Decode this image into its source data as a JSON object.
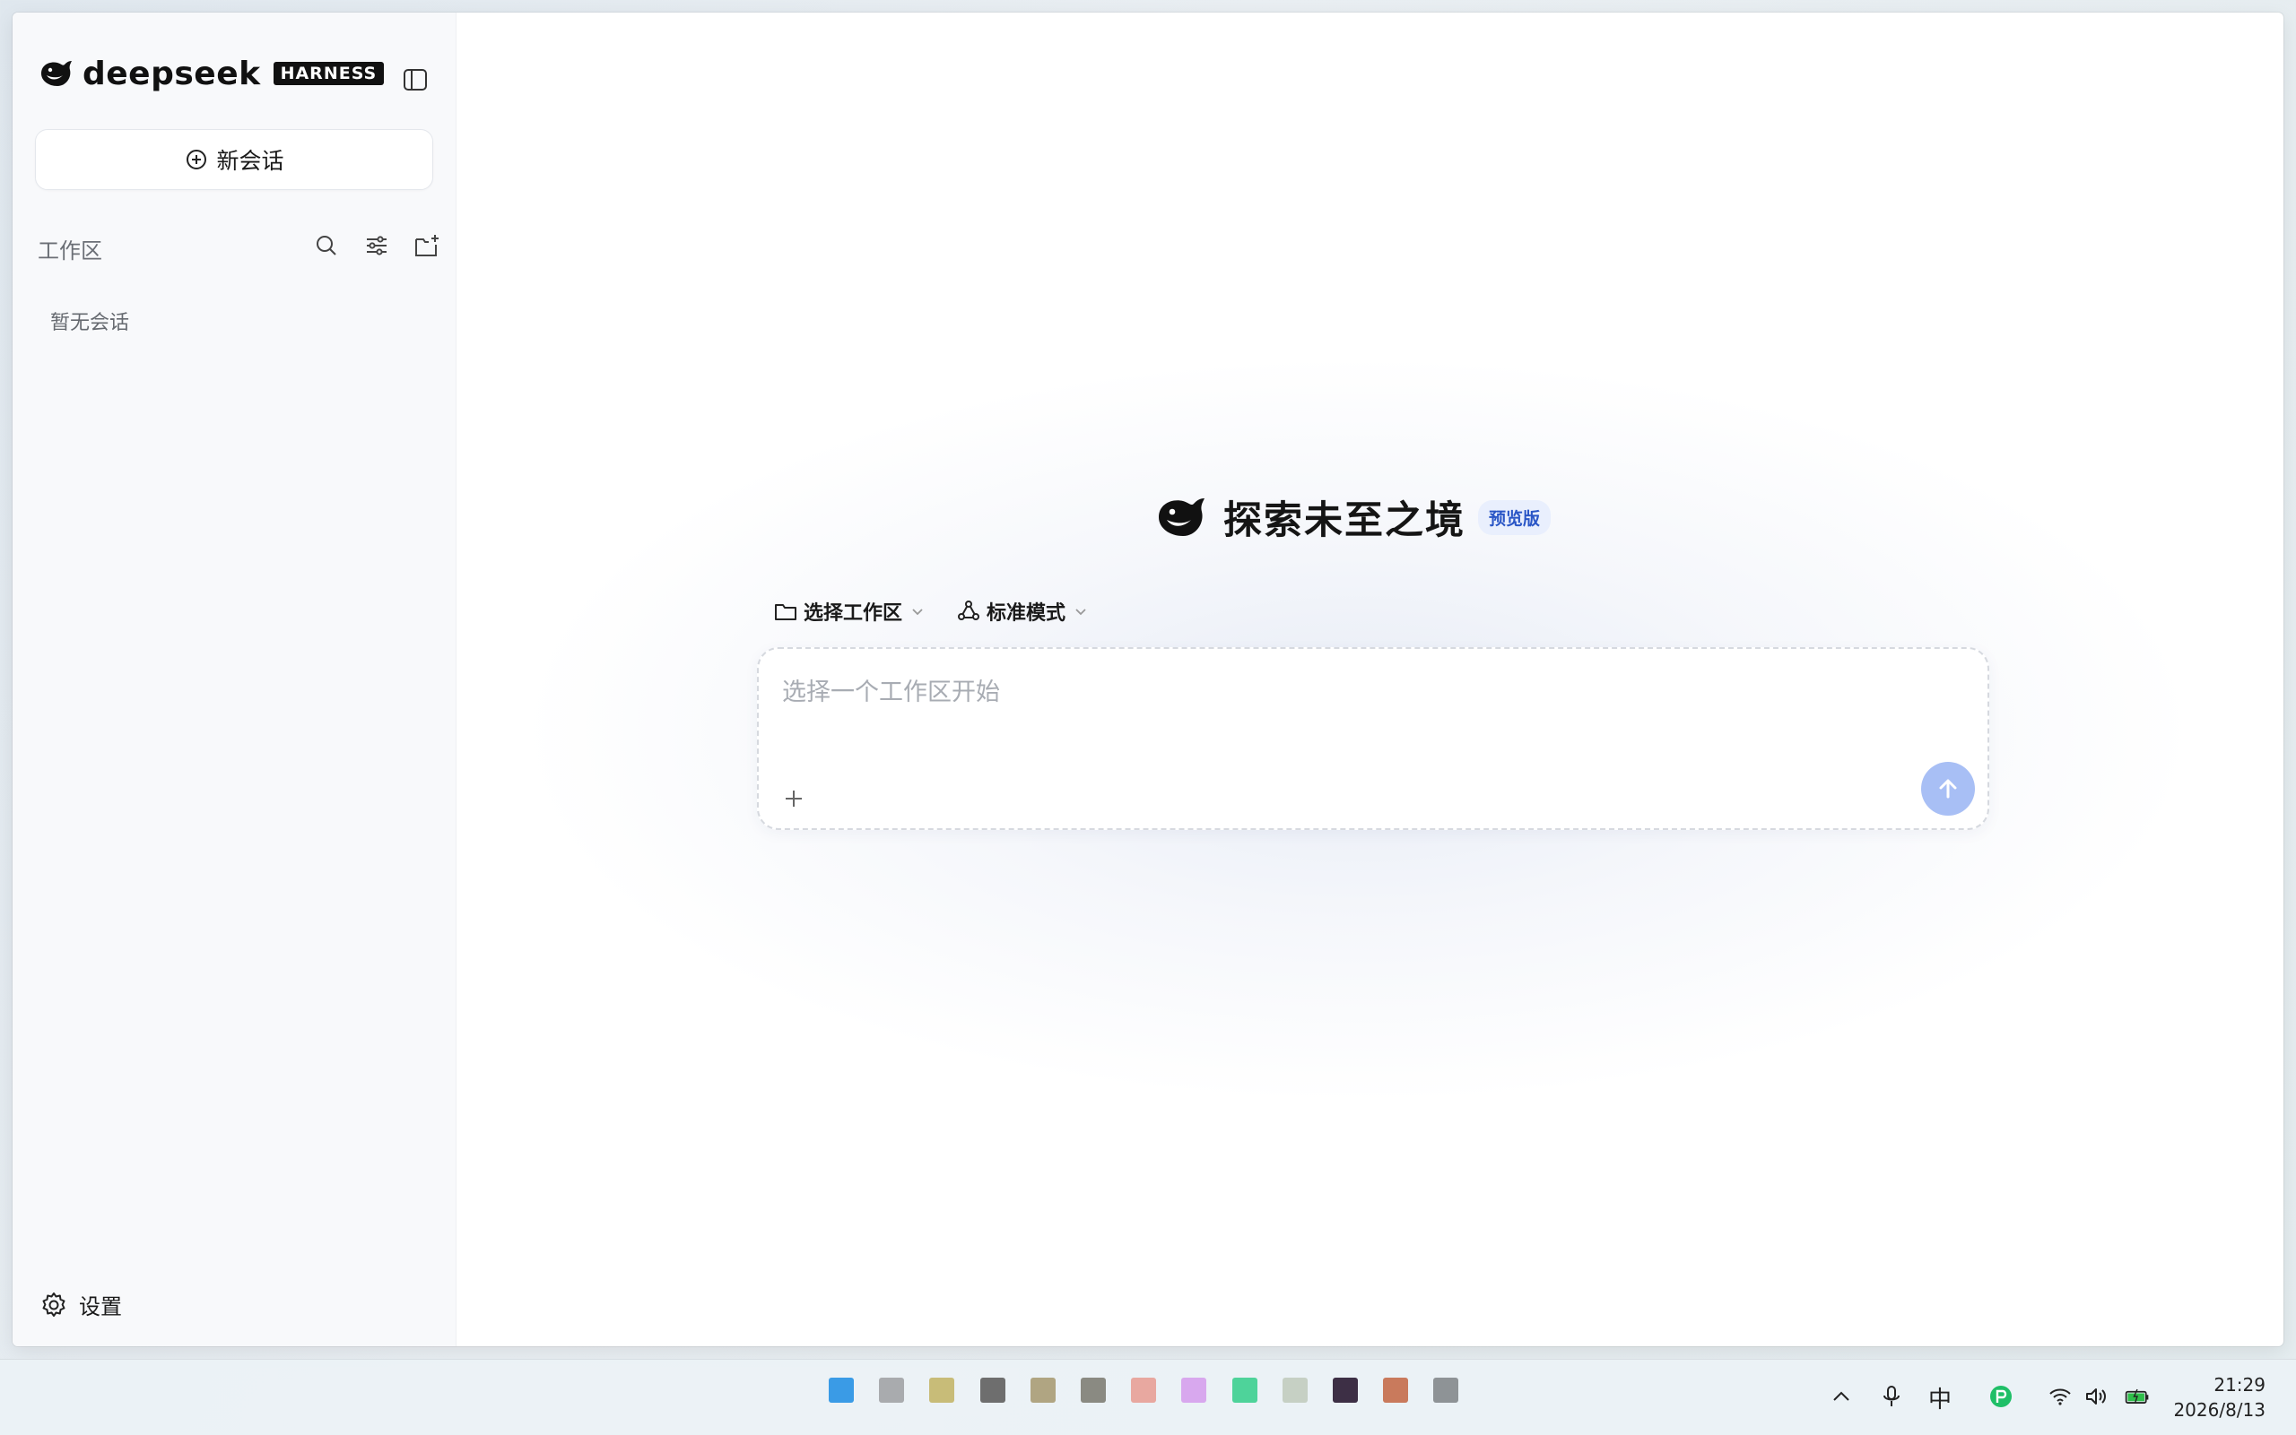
{
  "sidebar": {
    "brand_name": "deepseek",
    "brand_badge": "HARNESS",
    "new_chat_label": "新会话",
    "workspace_label": "工作区",
    "empty_text": "暂无会话",
    "settings_label": "设置"
  },
  "main": {
    "hero_title": "探索未至之境",
    "hero_badge": "预览版",
    "workspace_selector": "选择工作区",
    "mode_selector": "标准模式",
    "input_placeholder": "选择一个工作区开始"
  },
  "taskbar": {
    "app_colors": [
      "#3a9be6",
      "#a9abae",
      "#c8bc78",
      "#6e6e6e",
      "#b0a582",
      "#8a8a82",
      "#e8a8a0",
      "#d8a8ee",
      "#4ed39a",
      "#c6d0c4",
      "#3d2f45",
      "#c97a5c",
      "#8e9396"
    ],
    "ime_label": "中",
    "time": "21:29",
    "date": "2026/8/13"
  },
  "colors": {
    "accent": "#2a56c6",
    "send_button": "#a8bff5",
    "sidebar_bg": "#f8f9fb"
  }
}
